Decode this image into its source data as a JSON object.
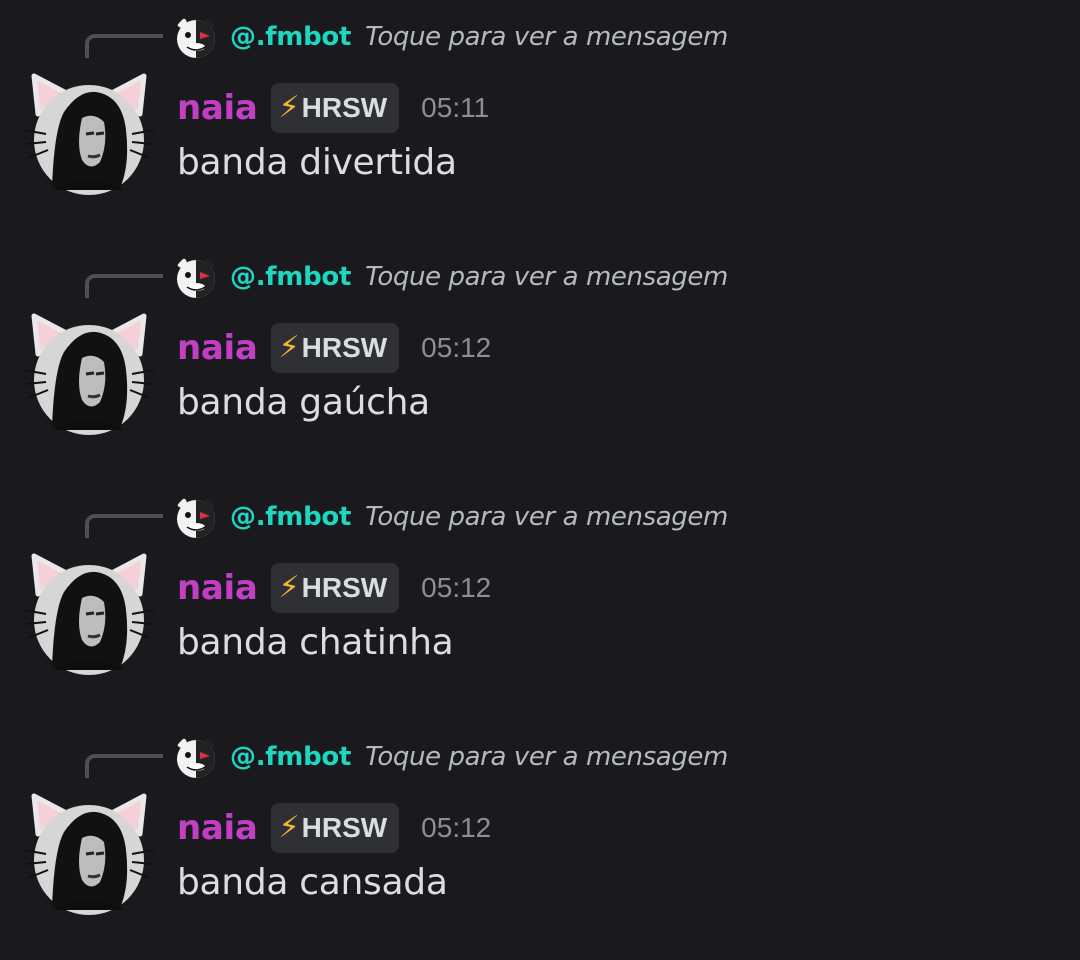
{
  "messages": [
    {
      "reply": {
        "author": "@.fmbot",
        "preview": "Toque para ver a mensagem"
      },
      "author": "naia",
      "tag": {
        "icon": "lightning-icon",
        "label": "HRSW"
      },
      "time": "05:11",
      "text": "banda divertida"
    },
    {
      "reply": {
        "author": "@.fmbot",
        "preview": "Toque para ver a mensagem"
      },
      "author": "naia",
      "tag": {
        "icon": "lightning-icon",
        "label": "HRSW"
      },
      "time": "05:12",
      "text": "banda gaúcha"
    },
    {
      "reply": {
        "author": "@.fmbot",
        "preview": "Toque para ver a mensagem"
      },
      "author": "naia",
      "tag": {
        "icon": "lightning-icon",
        "label": "HRSW"
      },
      "time": "05:12",
      "text": "banda chatinha"
    },
    {
      "reply": {
        "author": "@.fmbot",
        "preview": "Toque para ver a mensagem"
      },
      "author": "naia",
      "tag": {
        "icon": "lightning-icon",
        "label": "HRSW"
      },
      "time": "05:12",
      "text": "banda cansada"
    }
  ],
  "colors": {
    "background": "#1a1a1e",
    "reply_author": "#1fd6c1",
    "username": "#c13fc2",
    "tag_background": "#2e3035",
    "lightning": "#f5b82e",
    "timestamp": "#8b8e95"
  }
}
